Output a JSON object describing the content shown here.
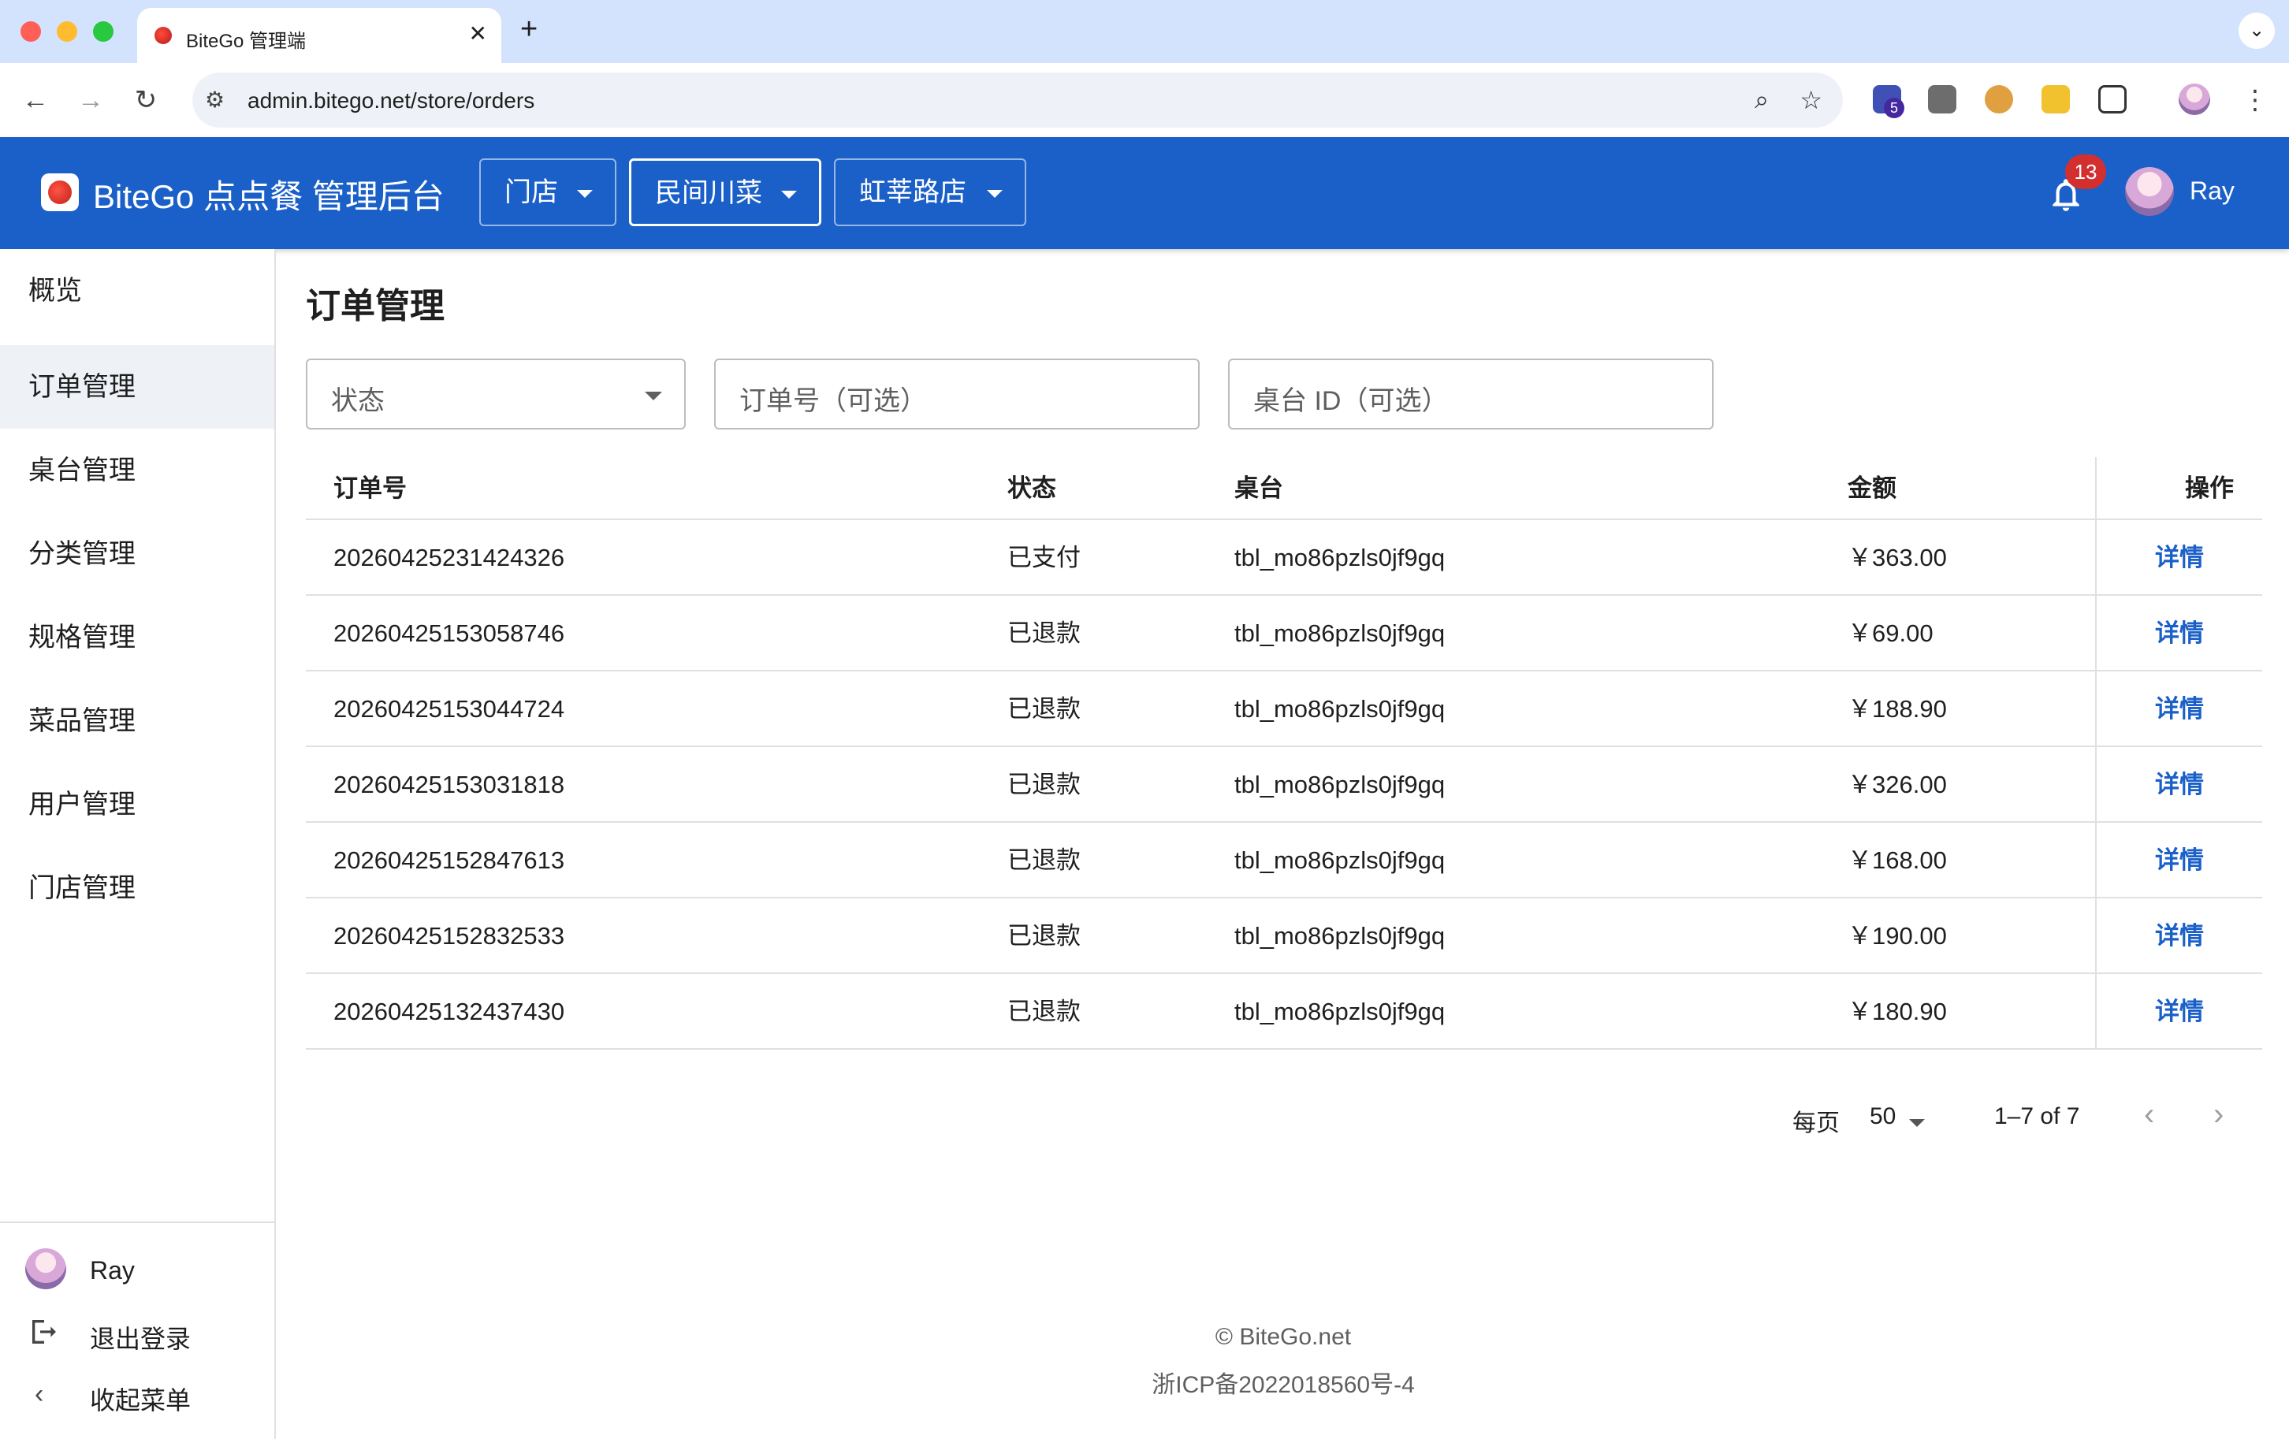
{
  "browser": {
    "tab_title": "BiteGo 管理端",
    "tab_close": "✕",
    "new_tab": "+",
    "tab_menu": "⌄",
    "url": "admin.bitego.net/store/orders",
    "extension_badge": "5"
  },
  "header": {
    "brand": "BiteGo 点点餐 管理后台",
    "selectors": [
      {
        "label": "门店"
      },
      {
        "label": "民间川菜"
      },
      {
        "label": "虹莘路店"
      }
    ],
    "notification_count": "13",
    "user_name": "Ray"
  },
  "sidebar": {
    "items": [
      {
        "label": "概览"
      },
      {
        "label": "订单管理"
      },
      {
        "label": "桌台管理"
      },
      {
        "label": "分类管理"
      },
      {
        "label": "规格管理"
      },
      {
        "label": "菜品管理"
      },
      {
        "label": "用户管理"
      },
      {
        "label": "门店管理"
      }
    ],
    "active_index": 1,
    "footer": {
      "user": "Ray",
      "logout": "退出登录",
      "collapse": "收起菜单"
    }
  },
  "main": {
    "title": "订单管理",
    "filters": {
      "status_label": "状态",
      "order_placeholder": "订单号（可选）",
      "table_placeholder": "桌台 ID（可选）"
    },
    "columns": [
      "订单号",
      "状态",
      "桌台",
      "金额",
      "操作"
    ],
    "rows": [
      {
        "order_no": "20260425231424326",
        "status": "已支付",
        "table": "tbl_mo86pzls0jf9gq",
        "amount": "￥363.00",
        "action": "详情"
      },
      {
        "order_no": "20260425153058746",
        "status": "已退款",
        "table": "tbl_mo86pzls0jf9gq",
        "amount": "￥69.00",
        "action": "详情"
      },
      {
        "order_no": "20260425153044724",
        "status": "已退款",
        "table": "tbl_mo86pzls0jf9gq",
        "amount": "￥188.90",
        "action": "详情"
      },
      {
        "order_no": "20260425153031818",
        "status": "已退款",
        "table": "tbl_mo86pzls0jf9gq",
        "amount": "￥326.00",
        "action": "详情"
      },
      {
        "order_no": "20260425152847613",
        "status": "已退款",
        "table": "tbl_mo86pzls0jf9gq",
        "amount": "￥168.00",
        "action": "详情"
      },
      {
        "order_no": "20260425152832533",
        "status": "已退款",
        "table": "tbl_mo86pzls0jf9gq",
        "amount": "￥190.00",
        "action": "详情"
      },
      {
        "order_no": "20260425132437430",
        "status": "已退款",
        "table": "tbl_mo86pzls0jf9gq",
        "amount": "￥180.90",
        "action": "详情"
      }
    ],
    "pagination": {
      "per_page_label": "每页",
      "per_page": "50",
      "range": "1–7 of 7"
    }
  },
  "footer": {
    "copyright": "© BiteGo.net",
    "icp": "浙ICP备2022018560号-4"
  },
  "colors": {
    "primary": "#1a60c8",
    "badge": "#d32f2f",
    "chrome": "#d3e3fd"
  }
}
